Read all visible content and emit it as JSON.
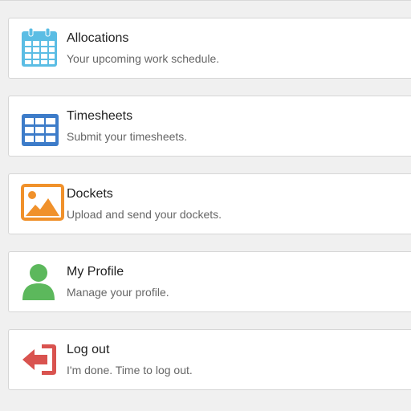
{
  "menu": {
    "items": [
      {
        "title": "Allocations",
        "subtitle": "Your upcoming work schedule.",
        "icon": "calendar-icon",
        "color": "#5bbde4"
      },
      {
        "title": "Timesheets",
        "subtitle": "Submit your timesheets.",
        "icon": "table-icon",
        "color": "#3d7cc9"
      },
      {
        "title": "Dockets",
        "subtitle": "Upload and send your dockets.",
        "icon": "image-icon",
        "color": "#f0912b"
      },
      {
        "title": "My Profile",
        "subtitle": "Manage your profile.",
        "icon": "user-icon",
        "color": "#5cb85c"
      },
      {
        "title": "Log out",
        "subtitle": "I'm done. Time to log out.",
        "icon": "sign-out-icon",
        "color": "#d9534f"
      }
    ]
  }
}
